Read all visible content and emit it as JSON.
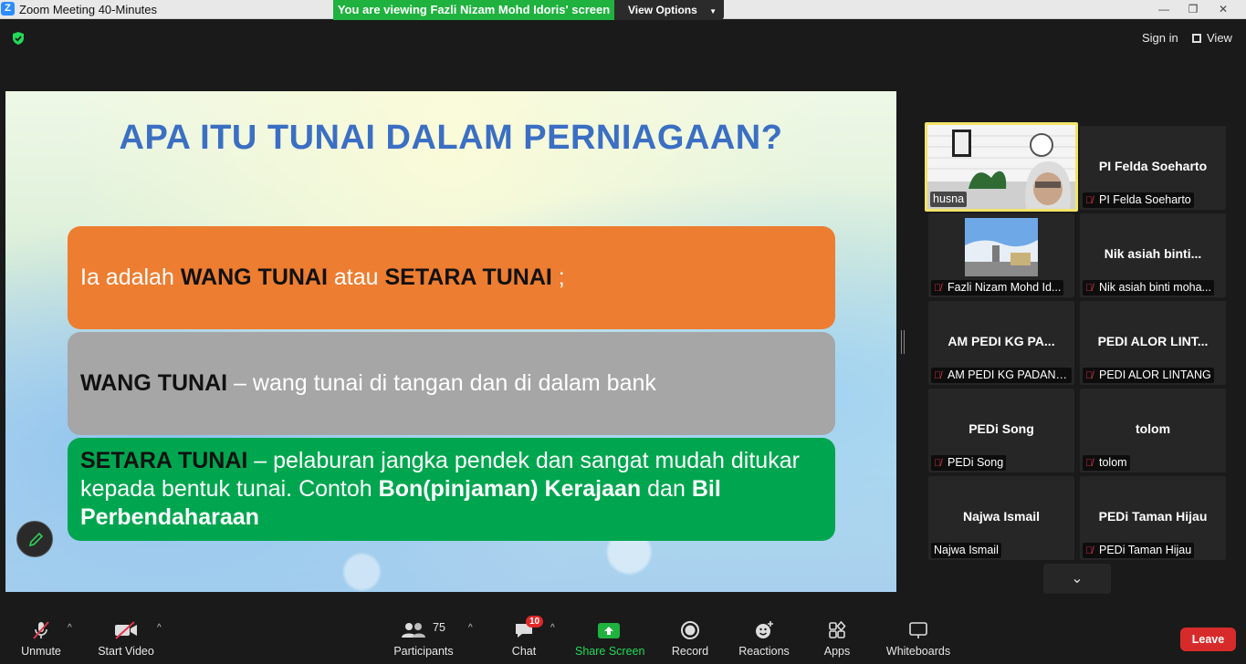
{
  "window": {
    "title": "Zoom Meeting 40-Minutes",
    "app_icon_letter": "Z"
  },
  "share_banner": {
    "text": "You are viewing Fazli Nizam Mohd Idoris' screen",
    "view_options_label": "View Options"
  },
  "topbar": {
    "sign_in_label": "Sign in",
    "view_label": "View"
  },
  "slide": {
    "title": "APA ITU TUNAI DALAM PERNIAGAAN?",
    "box1": {
      "pre": "Ia adalah ",
      "b1": "WANG TUNAI",
      "mid": " atau ",
      "b2": "SETARA TUNAI",
      "post": " ;"
    },
    "box2": {
      "b1": "WANG TUNAI",
      "post": " – wang tunai di tangan dan di dalam bank"
    },
    "box3": {
      "b1": "SETARA TUNAI",
      "mid1": " – pelaburan jangka pendek dan sangat mudah ditukar kepada bentuk tunai. Contoh ",
      "b2": "Bon(pinjaman) Kerajaan",
      "mid2": " dan ",
      "b3": "Bil Perbendaharaan"
    }
  },
  "participants": [
    {
      "big": "",
      "label": "husna",
      "muted": false,
      "video": true
    },
    {
      "big": "PI Felda Soeharto",
      "label": "PI Felda Soeharto",
      "muted": true
    },
    {
      "big": "",
      "label": "Fazli Nizam Mohd Id...",
      "muted": true,
      "video": true
    },
    {
      "big": "Nik asiah  binti...",
      "label": "Nik asiah binti moha...",
      "muted": true
    },
    {
      "big": "AM PEDI KG PA...",
      "label": "AM PEDI KG PADANG...",
      "muted": true
    },
    {
      "big": "PEDI ALOR LINT...",
      "label": "PEDI ALOR LINTANG",
      "muted": true
    },
    {
      "big": "PEDi Song",
      "label": "PEDi Song",
      "muted": true
    },
    {
      "big": "tolom",
      "label": "tolom",
      "muted": true
    },
    {
      "big": "Najwa Ismail",
      "label": "Najwa Ismail",
      "muted": false
    },
    {
      "big": "PEDi Taman Hijau",
      "label": "PEDi Taman Hijau",
      "muted": true
    }
  ],
  "toolbar": {
    "unmute": "Unmute",
    "start_video": "Start Video",
    "participants": "Participants",
    "participants_count": "75",
    "chat": "Chat",
    "chat_badge": "10",
    "share_screen": "Share Screen",
    "record": "Record",
    "reactions": "Reactions",
    "apps": "Apps",
    "whiteboards": "Whiteboards",
    "leave": "Leave"
  },
  "colors": {
    "share_green": "#1fb23f",
    "leave_red": "#d72b2b",
    "active_speaker": "#f2e46a"
  }
}
